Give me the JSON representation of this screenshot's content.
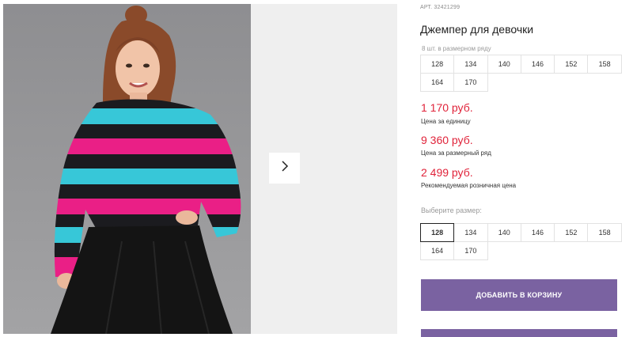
{
  "product": {
    "art_label": "АРТ. 32421299",
    "title": "Джемпер для девочки",
    "row_label": "8 шт. в размерном ряду"
  },
  "row_sizes": [
    "128",
    "134",
    "140",
    "146",
    "152",
    "158",
    "164",
    "170"
  ],
  "prices": {
    "unit_price": "1 170 руб.",
    "unit_note": "Цена за единицу",
    "row_price": "9 360 руб.",
    "row_note": "Цена за размерный ряд",
    "retail_price": "2 499 руб.",
    "retail_note": "Рекомендуемая розничная цена"
  },
  "size_picker": {
    "label": "Выберите размер:",
    "sizes": [
      "128",
      "134",
      "140",
      "146",
      "152",
      "158",
      "164",
      "170"
    ],
    "selected": "128"
  },
  "actions": {
    "add_to_cart": "ДОБАВИТЬ В КОРЗИНУ"
  },
  "icons": {
    "next": "chevron-right-icon"
  },
  "colors": {
    "price": "#e0233a",
    "button": "#7a62a1"
  }
}
